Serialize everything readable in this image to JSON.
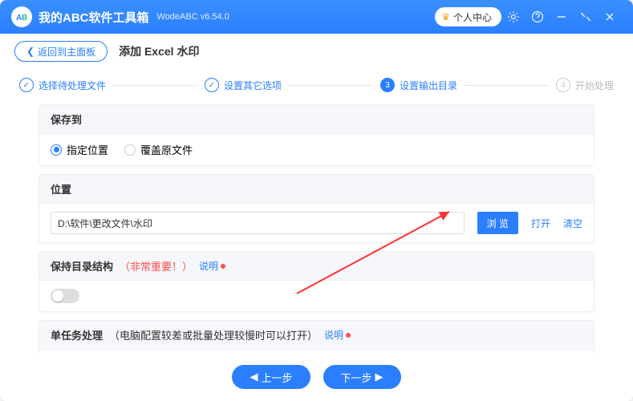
{
  "titlebar": {
    "app_title": "我的ABC软件工具箱",
    "version": "WodeABC v6.54.0",
    "user_center": "个人中心"
  },
  "subheader": {
    "back_label": "返回到主面板",
    "page_title": "添加 Excel 水印"
  },
  "steps": {
    "s1": "选择待处理文件",
    "s2": "设置其它选项",
    "s3_num": "3",
    "s3": "设置输出目录",
    "s4_num": "4",
    "s4": "开始处理"
  },
  "save_to": {
    "title": "保存到",
    "opt1": "指定位置",
    "opt2": "覆盖原文件"
  },
  "location": {
    "title": "位置",
    "path": "D:\\软件\\更改文件\\水印",
    "browse": "浏 览",
    "open": "打开",
    "clear": "清空"
  },
  "keep_structure": {
    "title": "保持目录结构",
    "important": "（非常重要！）",
    "help": "说明"
  },
  "single_task": {
    "title": "单任务处理",
    "note": "（电脑配置较差或批量处理较慢时可以打开）",
    "help": "说明"
  },
  "footer": {
    "prev": "上一步",
    "next": "下一步"
  }
}
